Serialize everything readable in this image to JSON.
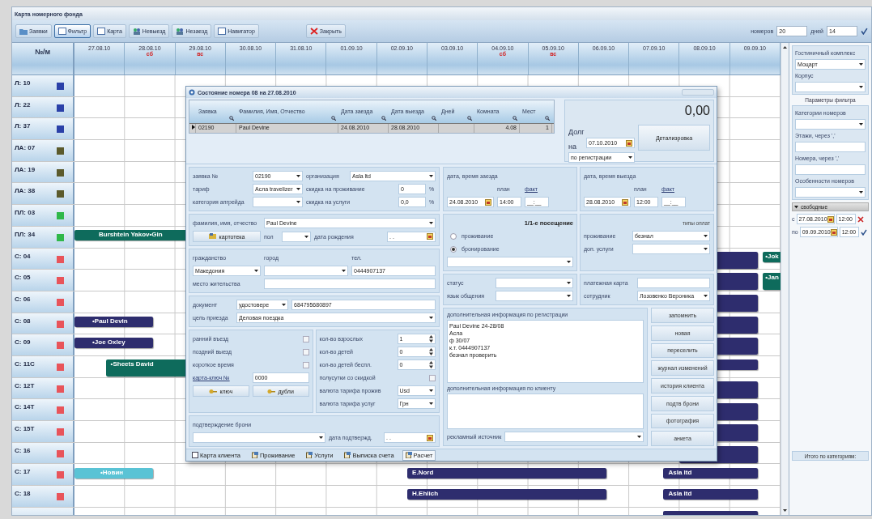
{
  "window": {
    "title": "Карта номерного фонда"
  },
  "toolbar": {
    "buttons": [
      {
        "label": "Заявки",
        "selected": false
      },
      {
        "label": "Фильтр",
        "selected": true
      },
      {
        "label": "Карта",
        "selected": false
      },
      {
        "label": "Невыезд",
        "selected": false
      },
      {
        "label": "Незаезд",
        "selected": false
      },
      {
        "label": "Навигатор",
        "selected": false
      },
      {
        "label": "Закрыть",
        "selected": false
      }
    ],
    "rooms_count": {
      "label": "номеров",
      "value": "20"
    },
    "days": {
      "label": "дней",
      "value": "14"
    }
  },
  "grid": {
    "header": "№/м",
    "dates": [
      {
        "date": "27.08.10"
      },
      {
        "date": "28.08.10",
        "day": "сб"
      },
      {
        "date": "29.08.10",
        "day": "вс"
      },
      {
        "date": "30.08.10"
      },
      {
        "date": "31.08.10"
      },
      {
        "date": "01.09.10"
      },
      {
        "date": "02.09.10"
      },
      {
        "date": "03.09.10"
      },
      {
        "date": "04.09.10",
        "day": "сб"
      },
      {
        "date": "05.09.10",
        "day": "вс"
      },
      {
        "date": "06.09.10"
      },
      {
        "date": "07.09.10"
      },
      {
        "date": "08.09.10"
      },
      {
        "date": "09.09.10"
      }
    ],
    "rooms": [
      {
        "number": "Л: 10",
        "color": "#2a40a8"
      },
      {
        "number": "Л: 22",
        "color": "#2a40a8"
      },
      {
        "number": "Л: 37",
        "color": "#2a40a8"
      },
      {
        "number": "ЛА: 07",
        "color": "#5b5a2c"
      },
      {
        "number": "ЛА: 19",
        "color": "#5b5a2c"
      },
      {
        "number": "ЛА: 38",
        "color": "#5b5a2c"
      },
      {
        "number": "ПЛ: 03",
        "color": "#2fb84a"
      },
      {
        "number": "ПЛ: 34",
        "color": "#2fb84a"
      },
      {
        "number": "С: 04",
        "color": "#e8545a"
      },
      {
        "number": "С: 05",
        "color": "#e8545a"
      },
      {
        "number": "С: 06",
        "color": "#e8545a"
      },
      {
        "number": "С: 08",
        "color": "#e8545a"
      },
      {
        "number": "С: 09",
        "color": "#e8545a"
      },
      {
        "number": "С: 11С",
        "color": "#e8545a"
      },
      {
        "number": "С: 12Т",
        "color": "#e8545a"
      },
      {
        "number": "С: 14Т",
        "color": "#e8545a"
      },
      {
        "number": "С: 15Т",
        "color": "#e8545a"
      },
      {
        "number": "С: 16",
        "color": "#e8545a"
      },
      {
        "number": "С: 17",
        "color": "#e8545a"
      },
      {
        "number": "С: 18",
        "color": "#e8545a"
      }
    ],
    "bookings": [
      {
        "label": "Burshtein Yakov•Gin",
        "color": "#0e6b5c"
      },
      {
        "label": "•Paul Devin",
        "color": "#2e2d6e"
      },
      {
        "label": "•Joe Oxley",
        "color": "#2e2d6e"
      },
      {
        "label": "•Sheets David",
        "color": "#0e6b5c"
      },
      {
        "label": "•Новин",
        "color": "#5ac3d5"
      },
      {
        "label": "E.Nord",
        "color": "#2e2d6e"
      },
      {
        "label": "H.Ehlich",
        "color": "#2e2d6e"
      },
      {
        "label": "Asla ltd",
        "color": "#2e2d6e"
      },
      {
        "label": "Asla ltd",
        "color": "#2e2d6e"
      },
      {
        "color": "#2e2d6e"
      },
      {
        "color": "#2e2d6e"
      },
      {
        "color": "#2e2d6e"
      },
      {
        "color": "#2e2d6e"
      },
      {
        "color": "#2e2d6e"
      },
      {
        "color": "#2e2d6e"
      },
      {
        "color": "#2e2d6e"
      },
      {
        "color": "#2e2d6e"
      },
      {
        "color": "#2e2d6e"
      },
      {
        "color": "#2e2d6e"
      },
      {
        "color": "#2e2d6e"
      },
      {
        "label": "•Jok",
        "color": "#0e6b5c"
      },
      {
        "label": "•Jan",
        "color": "#0e6b5c"
      }
    ]
  },
  "dialog": {
    "title": "Состояние номера 08 на 27.08.2010",
    "table": {
      "columns": [
        {
          "label": "Заявка"
        },
        {
          "label": "Фамилия, Имя, Отчество"
        },
        {
          "label": "Дата заезда"
        },
        {
          "label": "Дата выезда"
        },
        {
          "label": "Дней"
        },
        {
          "label": "Комната"
        },
        {
          "label": "Мест"
        }
      ],
      "rows": [
        {
          "request": "02190",
          "name": "Paul Devine",
          "arrival": "24.08.2010",
          "departure": "28.08.2010",
          "room": "4.08",
          "places": "1",
          "selected": true
        }
      ]
    },
    "debt": {
      "label": "Долг",
      "on": "на",
      "date": "07.10.2010",
      "amount": "0,00",
      "basis": "по регистрации",
      "details": "Детализровка"
    },
    "left": [
      {
        "panels": [
          {
            "rows": [
              [
                {
                  "kind": "label",
                  "text": "заявка №"
                },
                {
                  "kind": "select",
                  "value": "02190"
                },
                {
                  "kind": "label",
                  "text": "организация"
                },
                {
                  "kind": "select",
                  "value": "Asla ltd"
                }
              ],
              [
                {
                  "kind": "label",
                  "text": "тариф"
                },
                {
                  "kind": "select",
                  "value": "Асла travelizer"
                },
                {
                  "kind": "label",
                  "text": "скидка на проживание"
                },
                {
                  "kind": "input",
                  "value": "0"
                },
                {
                  "kind": "label",
                  "text": "%"
                }
              ],
              [
                {
                  "kind": "label",
                  "text": "категория апгрейда"
                },
                {
                  "kind": "select"
                },
                {
                  "kind": "label",
                  "text": "скидка на услуги"
                },
                {
                  "kind": "input",
                  "value": "0,0"
                },
                {
                  "kind": "label",
                  "text": "%"
                }
              ]
            ]
          }
        ]
      },
      {
        "panels": [
          {
            "rows": [
              [
                {
                  "kind": "label",
                  "text": "фамилия, имя, отчество"
                },
                {
                  "kind": "select",
                  "value": "Paul Devine"
                }
              ],
              [
                {
                  "kind": "button",
                  "text": "картотека"
                },
                {
                  "kind": "label",
                  "text": "пол"
                },
                {
                  "kind": "select"
                },
                {
                  "kind": "label",
                  "text": "дата рождения"
                },
                {
                  "kind": "date",
                  "value": ". ."
                }
              ]
            ]
          }
        ]
      },
      {
        "panels": [
          {
            "rows": [
              [
                {
                  "kind": "label",
                  "text": "гражданство"
                },
                {
                  "kind": "label",
                  "text": "город"
                },
                {
                  "kind": "label",
                  "text": "тел."
                }
              ],
              [
                {
                  "kind": "select",
                  "value": "Македония"
                },
                {
                  "kind": "select"
                },
                {
                  "kind": "input",
                  "value": "0444907137"
                }
              ],
              [
                {
                  "kind": "label",
                  "text": "место жительства"
                },
                {
                  "kind": "input"
                }
              ]
            ]
          }
        ]
      },
      {
        "panels": [
          {
            "rows": [
              [
                {
                  "kind": "label",
                  "text": "документ"
                },
                {
                  "kind": "select",
                  "value": "удостовере"
                },
                {
                  "kind": "input",
                  "value": "684795680897"
                }
              ],
              [
                {
                  "kind": "label",
                  "text": "цель приезда"
                },
                {
                  "kind": "select",
                  "value": "Деловая поездка"
                }
              ]
            ]
          }
        ]
      },
      {
        "panels": [
          {
            "rows": [
              [
                {
                  "kind": "check",
                  "text": "ранний въезд",
                  "checked": false
                }
              ],
              [
                {
                  "kind": "check",
                  "text": "поздний выезд",
                  "checked": false
                }
              ],
              [
                {
                  "kind": "check",
                  "text": "короткое время",
                  "checked": false
                }
              ],
              [
                {
                  "kind": "link",
                  "text": "карта-ключ №"
                },
                {
                  "kind": "input",
                  "value": "0000"
                }
              ],
              [
                {
                  "kind": "button",
                  "text": "ключ"
                },
                {
                  "kind": "button",
                  "text": "дубли"
                }
              ]
            ]
          },
          {
            "rows": [
              [
                {
                  "kind": "label",
                  "text": "кол-во взрослых"
                },
                {
                  "kind": "spin",
                  "value": "1"
                }
              ],
              [
                {
                  "kind": "label",
                  "text": "кол-во детей"
                },
                {
                  "kind": "spin",
                  "value": "0"
                }
              ],
              [
                {
                  "kind": "label",
                  "text": "кол-во детей беспл."
                },
                {
                  "kind": "spin",
                  "value": "0"
                }
              ],
              [
                {
                  "kind": "check",
                  "text": "полусутки со скидкой",
                  "checked": false
                }
              ],
              [
                {
                  "kind": "label",
                  "text": "валюта тарифа прожив"
                },
                {
                  "kind": "select",
                  "value": "Usd"
                }
              ],
              [
                {
                  "kind": "label",
                  "text": "валюта тарифа услуг"
                },
                {
                  "kind": "select",
                  "value": "Грн"
                }
              ]
            ]
          }
        ]
      },
      {
        "panels": [
          {
            "rows": [
              [
                {
                  "kind": "label",
                  "text": "подтверждение брони"
                }
              ],
              [
                {
                  "kind": "select"
                },
                {
                  "kind": "label",
                  "text": "дата подтвержд."
                },
                {
                  "kind": "date",
                  "value": ". ."
                }
              ]
            ]
          }
        ]
      }
    ],
    "right": [
      {
        "panels": [
          {
            "rows": [
              [
                {
                  "kind": "label",
                  "text": "дата, время заезда"
                }
              ],
              [
                "",
                {
                  "kind": "label",
                  "text": "план"
                },
                {
                  "kind": "link",
                  "text": "факт"
                }
              ],
              [
                {
                  "kind": "date",
                  "value": "24.08.2010"
                },
                {
                  "kind": "input",
                  "value": "14:00"
                },
                {
                  "kind": "input",
                  "value": "__:__"
                }
              ]
            ]
          },
          {
            "rows": [
              [
                {
                  "kind": "label",
                  "text": "дата, время выезда"
                }
              ],
              [
                "",
                {
                  "kind": "label",
                  "text": "план"
                },
                {
                  "kind": "link",
                  "text": "факт"
                }
              ],
              [
                {
                  "kind": "date",
                  "value": "28.08.2010"
                },
                {
                  "kind": "input",
                  "value": "12:00"
                },
                {
                  "kind": "input",
                  "value": "__:__"
                }
              ]
            ]
          }
        ]
      },
      {
        "panels": [
          {
            "rows": [
              [
                {
                  "kind": "heading",
                  "text": "1/1-е посещение"
                }
              ],
              [
                {
                  "kind": "radio",
                  "text": "проживание",
                  "selected": false
                }
              ],
              [
                {
                  "kind": "radio",
                  "text": "бронирование",
                  "selected": true
                }
              ],
              [
                {
                  "kind": "select"
                }
              ]
            ]
          },
          {
            "rows": [
              [
                {
                  "kind": "note",
                  "text": "типы оплат"
                }
              ],
              [
                {
                  "kind": "label",
                  "text": "проживание"
                },
                {
                  "kind": "select",
                  "value": "безнал"
                }
              ],
              [
                {
                  "kind": "label",
                  "text": "доп. услуги"
                },
                {
                  "kind": "select"
                }
              ]
            ]
          }
        ]
      },
      {
        "panels": [
          {
            "rows": [
              [
                {
                  "kind": "label",
                  "text": "статус"
                },
                {
                  "kind": "select"
                }
              ],
              [
                {
                  "kind": "label",
                  "text": "язык общения"
                },
                {
                  "kind": "select"
                }
              ]
            ]
          },
          {
            "rows": [
              [
                {
                  "kind": "label",
                  "text": "платежная карта"
                },
                {
                  "kind": "input"
                }
              ],
              [
                {
                  "kind": "label",
                  "text": "сотрудник"
                },
                {
                  "kind": "select",
                  "value": "Лозовенко Вероника"
                }
              ]
            ]
          }
        ]
      }
    ],
    "notes": {
      "registration": {
        "label": "дополнительная информация по регистрации",
        "lines": [
          "Paul Devine 24-28/08",
          "Асла",
          "ф 30/07",
          "к.т. 0444907137",
          "безнал проверить"
        ]
      },
      "client": {
        "label": "дополнительная информация по клиенту"
      },
      "ad_source": {
        "label": "рекламный источник"
      }
    },
    "actions": [
      "запомнить",
      "новая",
      "переселить",
      "журнал изменений",
      "история клиента",
      "подтв брони",
      "фотография",
      "анкета"
    ],
    "tabs": [
      {
        "label": "Карта клиента",
        "selected": false
      },
      {
        "label": "Проживание",
        "selected": false
      },
      {
        "label": "Услуги",
        "selected": false
      },
      {
        "label": "Выписка счета",
        "selected": false
      },
      {
        "label": "Расчет",
        "selected": true
      }
    ]
  },
  "filter_panel": {
    "hotel": [
      {
        "kind": "label",
        "text": "Гостиничный комплекс"
      },
      {
        "kind": "select",
        "value": "Моцарт"
      },
      {
        "kind": "label",
        "text": "Корпус"
      },
      {
        "kind": "select"
      }
    ],
    "title": "Параметры фильтра",
    "filters": [
      {
        "kind": "label",
        "text": "Категории номеров"
      },
      {
        "kind": "select"
      },
      {
        "kind": "label",
        "text": "Этажи, через ','"
      },
      {
        "kind": "input"
      },
      {
        "kind": "label",
        "text": "Номера, через ','"
      },
      {
        "kind": "input"
      },
      {
        "kind": "label",
        "text": "Особенности номеров"
      },
      {
        "kind": "select"
      }
    ],
    "free": {
      "label": "свободные",
      "expanded": true,
      "rows": [
        [
          {
            "kind": "label",
            "text": "с"
          },
          {
            "kind": "date",
            "value": "27.08.2010"
          },
          {
            "kind": "input",
            "value": "12:00"
          },
          {
            "kind": "clear"
          }
        ],
        [
          {
            "kind": "label",
            "text": "по"
          },
          {
            "kind": "date",
            "value": "09.09.2010"
          },
          {
            "kind": "input",
            "value": "12:00"
          },
          {
            "kind": "apply"
          }
        ]
      ]
    },
    "total": "Итого по категориям:"
  }
}
